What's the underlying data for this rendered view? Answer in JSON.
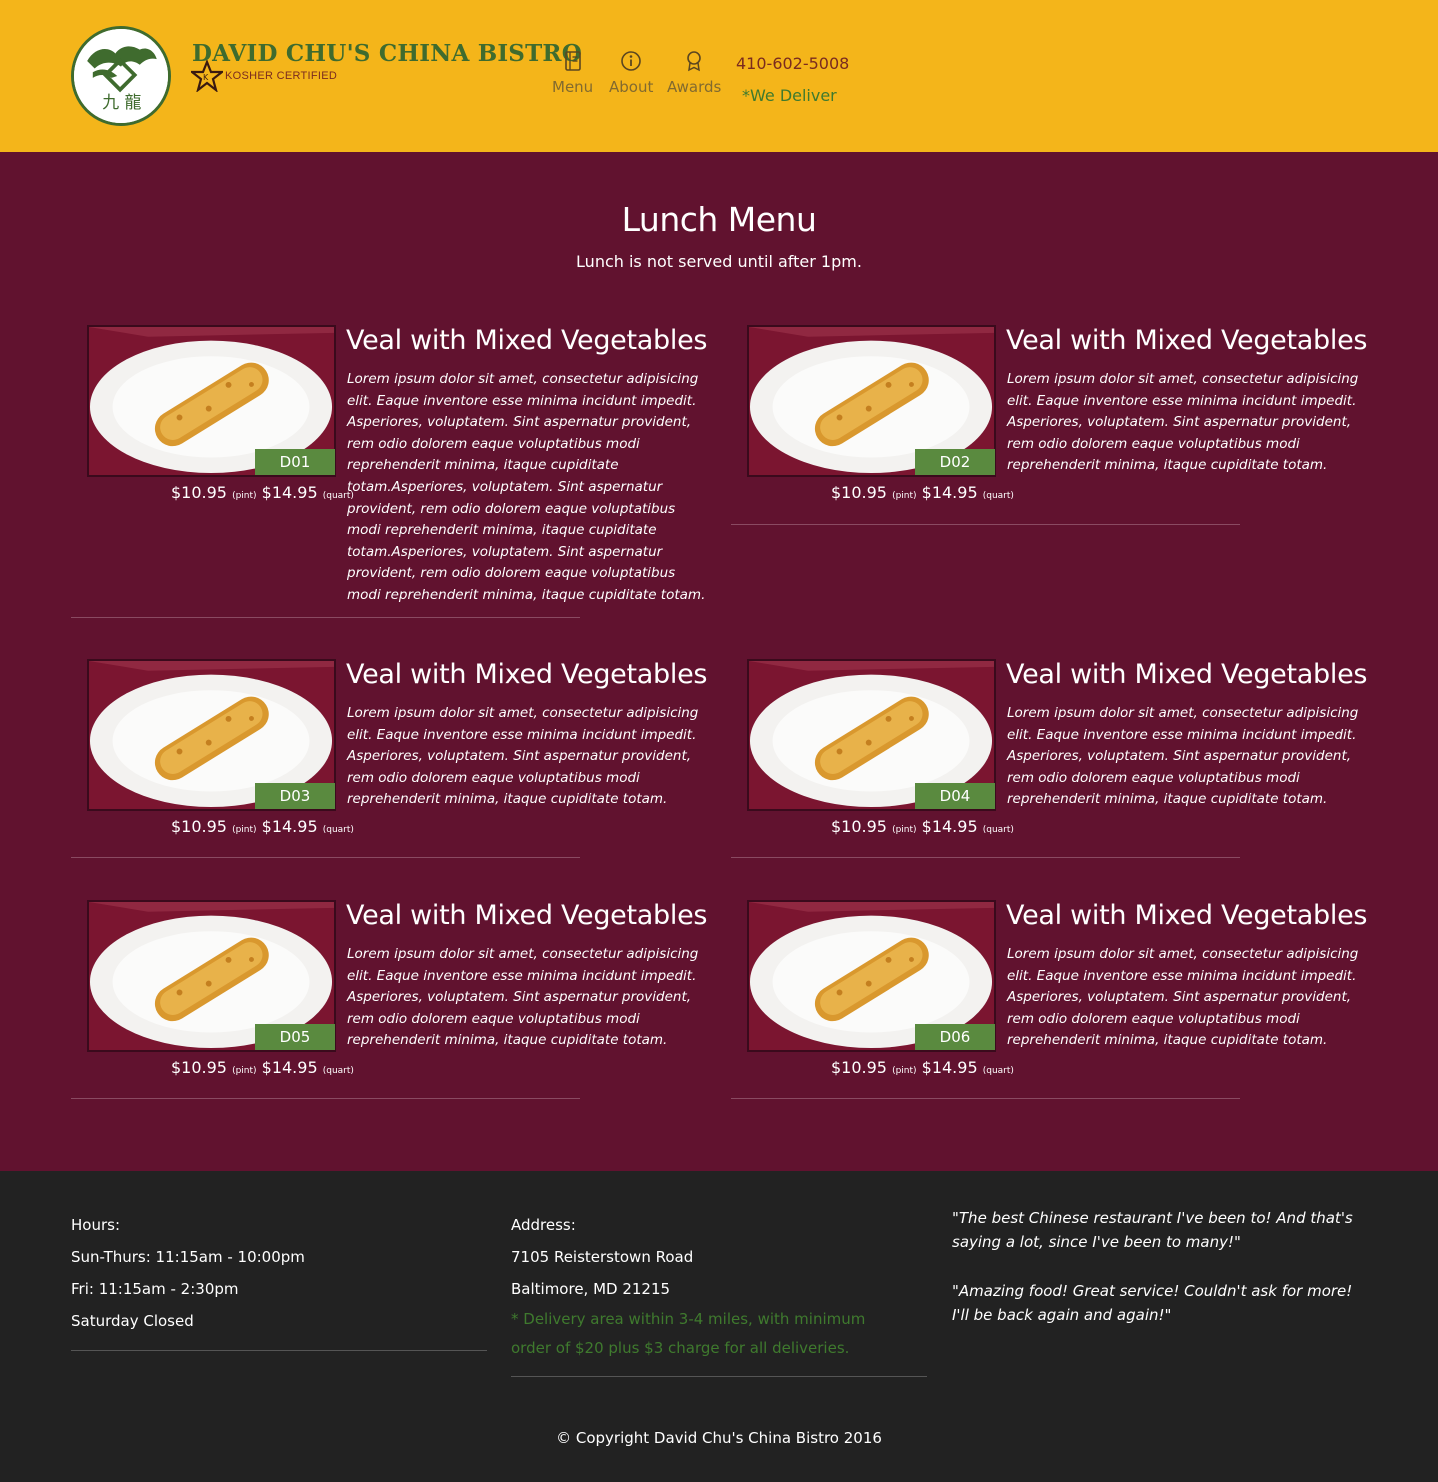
{
  "header": {
    "brand": "DAVID CHU'S CHINA BISTRO",
    "kosher": "KOSHER CERTIFIED",
    "nav": [
      {
        "label": "Menu",
        "icon": "book-icon"
      },
      {
        "label": "About",
        "icon": "info-icon"
      },
      {
        "label": "Awards",
        "icon": "award-icon"
      }
    ],
    "phone": "410-602-5008",
    "deliver": "*We Deliver"
  },
  "main": {
    "title": "Lunch Menu",
    "subtitle": "Lunch is not served until after 1pm.",
    "items": [
      {
        "code": "D01",
        "name": "Veal with Mixed Vegetables",
        "price_pint": "$10.95",
        "pint_label": "(pint)",
        "price_quart": "$14.95",
        "quart_label": "(quart)",
        "description": "Lorem ipsum dolor sit amet, consectetur adipisicing elit. Eaque inventore esse minima incidunt impedit. Asperiores, voluptatem. Sint aspernatur provident, rem odio dolorem eaque voluptatibus modi reprehenderit minima, itaque cupiditate totam.Asperiores, voluptatem. Sint aspernatur provident, rem odio dolorem eaque voluptatibus modi reprehenderit minima, itaque cupiditate totam.Asperiores, voluptatem. Sint aspernatur provident, rem odio dolorem eaque voluptatibus modi reprehenderit minima, itaque cupiditate totam."
      },
      {
        "code": "D02",
        "name": "Veal with Mixed Vegetables",
        "price_pint": "$10.95",
        "pint_label": "(pint)",
        "price_quart": "$14.95",
        "quart_label": "(quart)",
        "description": "Lorem ipsum dolor sit amet, consectetur adipisicing elit. Eaque inventore esse minima incidunt impedit. Asperiores, voluptatem. Sint aspernatur provident, rem odio dolorem eaque voluptatibus modi reprehenderit minima, itaque cupiditate totam."
      },
      {
        "code": "D03",
        "name": "Veal with Mixed Vegetables",
        "price_pint": "$10.95",
        "pint_label": "(pint)",
        "price_quart": "$14.95",
        "quart_label": "(quart)",
        "description": "Lorem ipsum dolor sit amet, consectetur adipisicing elit. Eaque inventore esse minima incidunt impedit. Asperiores, voluptatem. Sint aspernatur provident, rem odio dolorem eaque voluptatibus modi reprehenderit minima, itaque cupiditate totam."
      },
      {
        "code": "D04",
        "name": "Veal with Mixed Vegetables",
        "price_pint": "$10.95",
        "pint_label": "(pint)",
        "price_quart": "$14.95",
        "quart_label": "(quart)",
        "description": "Lorem ipsum dolor sit amet, consectetur adipisicing elit. Eaque inventore esse minima incidunt impedit. Asperiores, voluptatem. Sint aspernatur provident, rem odio dolorem eaque voluptatibus modi reprehenderit minima, itaque cupiditate totam."
      },
      {
        "code": "D05",
        "name": "Veal with Mixed Vegetables",
        "price_pint": "$10.95",
        "pint_label": "(pint)",
        "price_quart": "$14.95",
        "quart_label": "(quart)",
        "description": "Lorem ipsum dolor sit amet, consectetur adipisicing elit. Eaque inventore esse minima incidunt impedit. Asperiores, voluptatem. Sint aspernatur provident, rem odio dolorem eaque voluptatibus modi reprehenderit minima, itaque cupiditate totam."
      },
      {
        "code": "D06",
        "name": "Veal with Mixed Vegetables",
        "price_pint": "$10.95",
        "pint_label": "(pint)",
        "price_quart": "$14.95",
        "quart_label": "(quart)",
        "description": "Lorem ipsum dolor sit amet, consectetur adipisicing elit. Eaque inventore esse minima incidunt impedit. Asperiores, voluptatem. Sint aspernatur provident, rem odio dolorem eaque voluptatibus modi reprehenderit minima, itaque cupiditate totam."
      }
    ]
  },
  "footer": {
    "hours_title": "Hours:",
    "hours": [
      "Sun-Thurs: 11:15am - 10:00pm",
      "Fri: 11:15am - 2:30pm",
      "Saturday Closed"
    ],
    "address_title": "Address:",
    "address": [
      "7105 Reisterstown Road",
      "Baltimore, MD 21215"
    ],
    "delivery_note": "* Delivery area within 3-4 miles, with minimum order of $20 plus $3 charge for all deliveries.",
    "quotes": [
      "\"The best Chinese restaurant I've been to! And that's saying a lot, since I've been to many!\"",
      "\"Amazing food! Great service! Couldn't ask for more! I'll be back again and again!\""
    ],
    "copyright": "© Copyright David Chu's China Bistro 2016"
  },
  "colors": {
    "header_bg": "#f4b51a",
    "main_bg": "#61122f",
    "footer_bg": "#222222",
    "accent_green": "#5a8a3f",
    "brand_green": "#3f6b2e"
  }
}
